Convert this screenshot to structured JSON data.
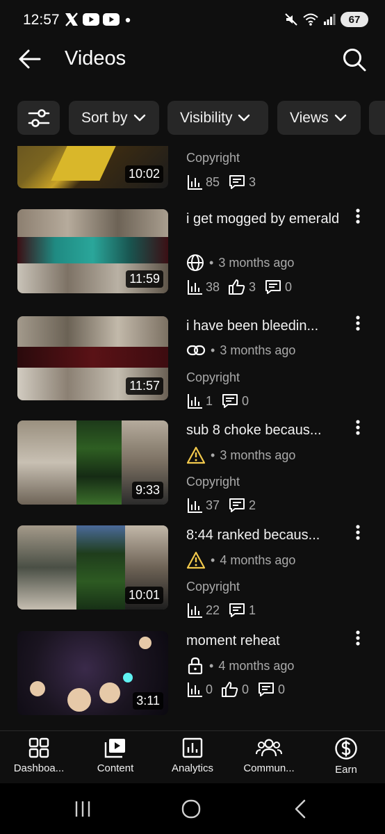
{
  "status_bar": {
    "time": "12:57",
    "battery": "67"
  },
  "app_bar": {
    "title": "Videos"
  },
  "chips": [
    {
      "label": "Sort by"
    },
    {
      "label": "Visibility"
    },
    {
      "label": "Views"
    }
  ],
  "videos": [
    {
      "title": "",
      "duration": "10:02",
      "visibility_icon": "none",
      "age": "",
      "copyright": "Copyright",
      "views": "85",
      "likes": null,
      "comments": "3"
    },
    {
      "title": "i get mogged by emerald",
      "duration": "11:59",
      "visibility_icon": "globe-icon",
      "age": "3 months ago",
      "copyright": "",
      "views": "38",
      "likes": "3",
      "comments": "0"
    },
    {
      "title": "i have been bleedin...",
      "duration": "11:57",
      "visibility_icon": "link-icon",
      "age": "3 months ago",
      "copyright": "Copyright",
      "views": "1",
      "likes": null,
      "comments": "0"
    },
    {
      "title": "sub 8 choke becaus...",
      "duration": "9:33",
      "visibility_icon": "warning-icon",
      "age": "3 months ago",
      "copyright": "Copyright",
      "views": "37",
      "likes": null,
      "comments": "2"
    },
    {
      "title": "8:44 ranked becaus...",
      "duration": "10:01",
      "visibility_icon": "warning-icon",
      "age": "4 months ago",
      "copyright": "Copyright",
      "views": "22",
      "likes": null,
      "comments": "1"
    },
    {
      "title": "moment reheat",
      "duration": "3:11",
      "visibility_icon": "lock-icon",
      "age": "4 months ago",
      "copyright": "",
      "views": "0",
      "likes": "0",
      "comments": "0"
    }
  ],
  "bottom_nav": [
    {
      "label": "Dashboa...",
      "icon": "dashboard-icon"
    },
    {
      "label": "Content",
      "icon": "content-icon"
    },
    {
      "label": "Analytics",
      "icon": "analytics-icon"
    },
    {
      "label": "Commun...",
      "icon": "community-icon"
    },
    {
      "label": "Earn",
      "icon": "dollar-icon"
    }
  ],
  "colors": {
    "background": "#0f0f0f",
    "chip": "#272727",
    "text": "#f1f1f1",
    "secondary": "#aaaaaa",
    "warning": "#f2c94c"
  }
}
